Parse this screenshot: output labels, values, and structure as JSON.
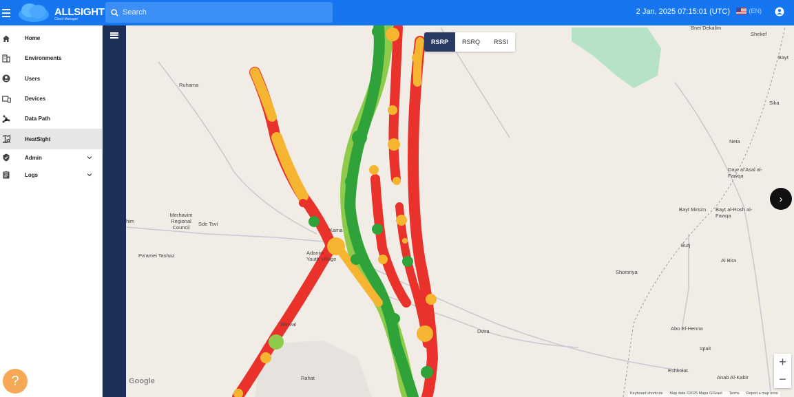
{
  "header": {
    "brand": "ALLSIGHT",
    "brand_sub": "Cloud Manager",
    "search_placeholder": "Search",
    "datetime": "2 Jan, 2025 07:15:01 (UTC)",
    "lang": "(EN)"
  },
  "sidebar": {
    "items": [
      {
        "label": "Home",
        "icon": "home-icon"
      },
      {
        "label": "Environments",
        "icon": "building-icon"
      },
      {
        "label": "Users",
        "icon": "user-circle-icon"
      },
      {
        "label": "Devices",
        "icon": "devices-icon"
      },
      {
        "label": "Data Path",
        "icon": "data-path-icon"
      },
      {
        "label": "HeatSight",
        "icon": "map-search-icon",
        "active": true
      },
      {
        "label": "Admin",
        "icon": "shield-icon"
      },
      {
        "label": "Logs",
        "icon": "clipboard-icon"
      }
    ]
  },
  "help": {
    "label": "?"
  },
  "metric_tabs": [
    "RSRP",
    "RSRQ",
    "RSSI"
  ],
  "metric_active": "RSRP",
  "map": {
    "labels": [
      {
        "text": "Bnei Dekalim"
      },
      {
        "text": "Shekef"
      },
      {
        "text": "Ruhama"
      },
      {
        "text": "Sika"
      },
      {
        "text": "Neta"
      },
      {
        "text": "Dayr al'Asal al-Fawqa"
      },
      {
        "text": "Bayt Mirsim"
      },
      {
        "text": "Bayt al-Rosh al-Fawqa"
      },
      {
        "text": "Merhavim Regional Council"
      },
      {
        "text": "Sde Tsvi"
      },
      {
        "text": "Pa'amei Tashaz"
      },
      {
        "text": "Kama"
      },
      {
        "text": "Adanim Youth Village"
      },
      {
        "text": "Burj"
      },
      {
        "text": "Al Bira"
      },
      {
        "text": "Shomriya"
      },
      {
        "text": "Dvira"
      },
      {
        "text": "Abo El-Henna"
      },
      {
        "text": "Iqtait"
      },
      {
        "text": "Eshkolot"
      },
      {
        "text": "Anab Al-Kabir"
      },
      {
        "text": "Rahat"
      },
      {
        "text": "Shoval"
      },
      {
        "text": "Bayt"
      },
      {
        "text": "him"
      }
    ],
    "google": "Google",
    "attribution": [
      "Keyboard shortcuts",
      "Map data ©2025 Mapa GISrael",
      "Terms",
      "Report a map error"
    ]
  },
  "controls": {
    "next": "›",
    "zoom_in": "+",
    "zoom_out": "−"
  },
  "colors": {
    "topbar": "#1576f0",
    "rail": "#1e2f5a",
    "red": "#e8322b",
    "green": "#2fa339",
    "yellow": "#f5b531"
  }
}
